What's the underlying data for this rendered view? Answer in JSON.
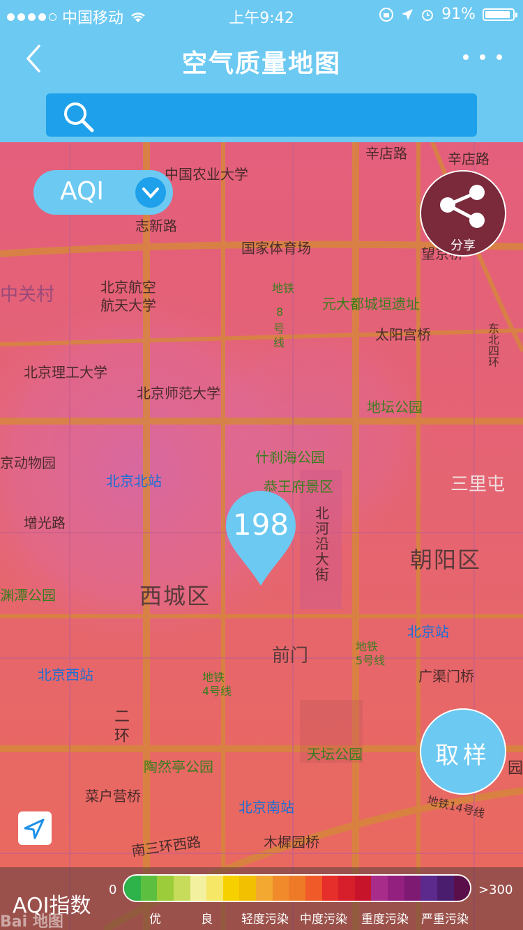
{
  "status_bar": {
    "carrier": "中国移动",
    "time": "上午9:42",
    "battery": "91%",
    "battery_level": 0.91
  },
  "nav": {
    "title": "空气质量地图"
  },
  "search": {
    "placeholder": ""
  },
  "map": {
    "aqi_selector": "AQI",
    "share_label": "分享",
    "sample_label": "取样",
    "pin_value": "198",
    "labels": [
      "辛店路",
      "中国农业大学",
      "辛店路",
      "志新路",
      "国家体育场",
      "望京桥",
      "中关村",
      "北京航空",
      "航天大学",
      "元大都城垣遗址",
      "地铁",
      "8",
      "号",
      "线",
      "太阳宫桥",
      "北京理工大学",
      "北京师范大学",
      "地坛公园",
      "什刹海公园",
      "京动物园",
      "北京北站",
      "恭王府景区",
      "三里屯",
      "增光路",
      "北",
      "河",
      "沿",
      "大",
      "街",
      "朝阳区",
      "渊潭公园",
      "西城区",
      "北京站",
      "前门",
      "北京西站",
      "广渠门桥",
      "二",
      "环",
      "天坛公园",
      "陶然亭公园",
      "菜户营桥",
      "北京南站",
      "木樨园桥",
      "南三环西路",
      "园",
      "地铁14号线",
      "东",
      "北",
      "四",
      "环",
      "地铁",
      "5号线",
      "地铁",
      "4号线"
    ]
  },
  "legend": {
    "title": "AQI指数",
    "min": "0",
    "max": ">300",
    "colors": [
      "#2db34a",
      "#5cbf3f",
      "#9ccc3a",
      "#c6dc5a",
      "#f3f0a0",
      "#f6e866",
      "#f7d000",
      "#f2c000",
      "#f3a832",
      "#f08a2a",
      "#ee7a28",
      "#f05a28",
      "#e62e2a",
      "#d61f2a",
      "#c8142a",
      "#a82c8a",
      "#93207e",
      "#7e1a72",
      "#5c2a8c",
      "#4b1d6e",
      "#5a0f4a"
    ],
    "categories": [
      "优",
      "良",
      "轻度污染",
      "中度污染",
      "重度污染",
      "严重污染"
    ]
  },
  "watermark": "Bai 地图"
}
